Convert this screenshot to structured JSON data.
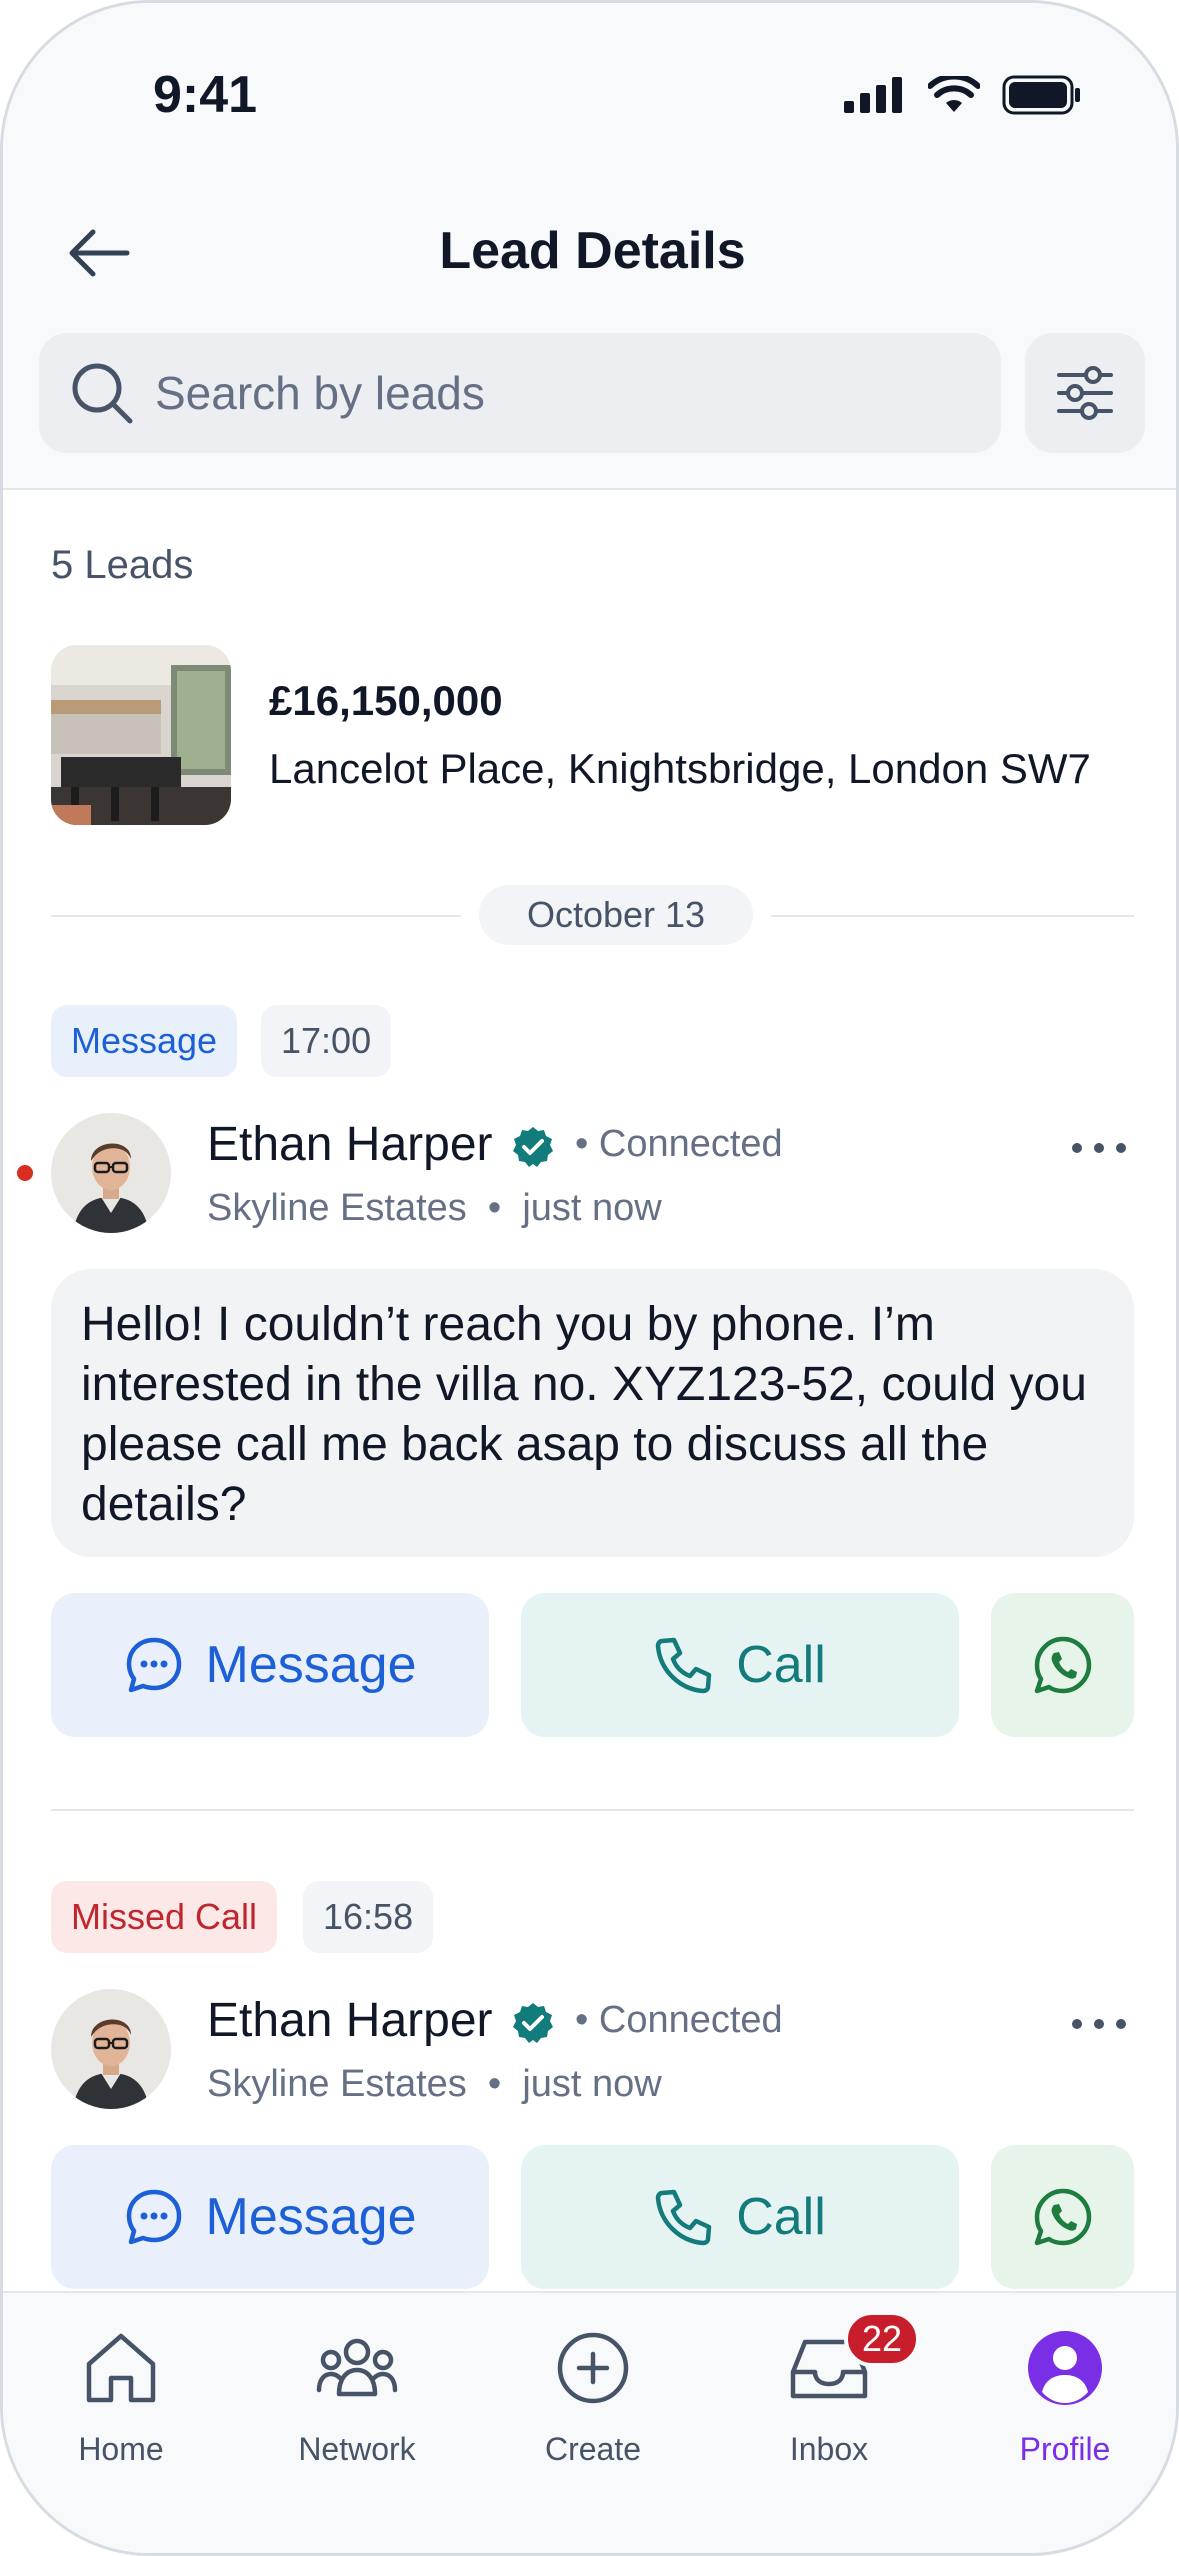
{
  "status_bar": {
    "time": "9:41"
  },
  "header": {
    "title": "Lead Details"
  },
  "search": {
    "placeholder": "Search by leads"
  },
  "leads": {
    "count_label": "5 Leads",
    "property": {
      "price": "£16,150,000",
      "address": "Lancelot Place, Knightsbridge, London SW7"
    },
    "date_label": "October 13",
    "items": [
      {
        "type_label": "Message",
        "time": "17:00",
        "name": "Ethan Harper",
        "status": "Connected",
        "company": "Skyline Estates",
        "when": "just now",
        "unread": true,
        "message": "Hello! I couldn’t reach you by phone. I’m interested in the villa no. XYZ123-52, could you please call me back asap to discuss all the details?",
        "actions": {
          "message": "Message",
          "call": "Call"
        }
      },
      {
        "type_label": "Missed Call",
        "time": "16:58",
        "name": "Ethan Harper",
        "status": "Connected",
        "company": "Skyline Estates",
        "when": "just now",
        "unread": false,
        "actions": {
          "message": "Message",
          "call": "Call"
        }
      }
    ]
  },
  "tabbar": {
    "tabs": [
      {
        "label": "Home",
        "icon": "home-icon"
      },
      {
        "label": "Network",
        "icon": "network-icon"
      },
      {
        "label": "Create",
        "icon": "plus-circle-icon"
      },
      {
        "label": "Inbox",
        "icon": "inbox-icon",
        "badge": "22"
      },
      {
        "label": "Profile",
        "icon": "profile-icon",
        "active": true
      }
    ]
  },
  "colors": {
    "message_blue": "#1d5fd6",
    "call_teal": "#137b7b",
    "whatsapp_green": "#1d7c3e",
    "missed_red": "#c0262d",
    "active_purple": "#7a2ee6",
    "verified_teal": "#127c7c"
  }
}
